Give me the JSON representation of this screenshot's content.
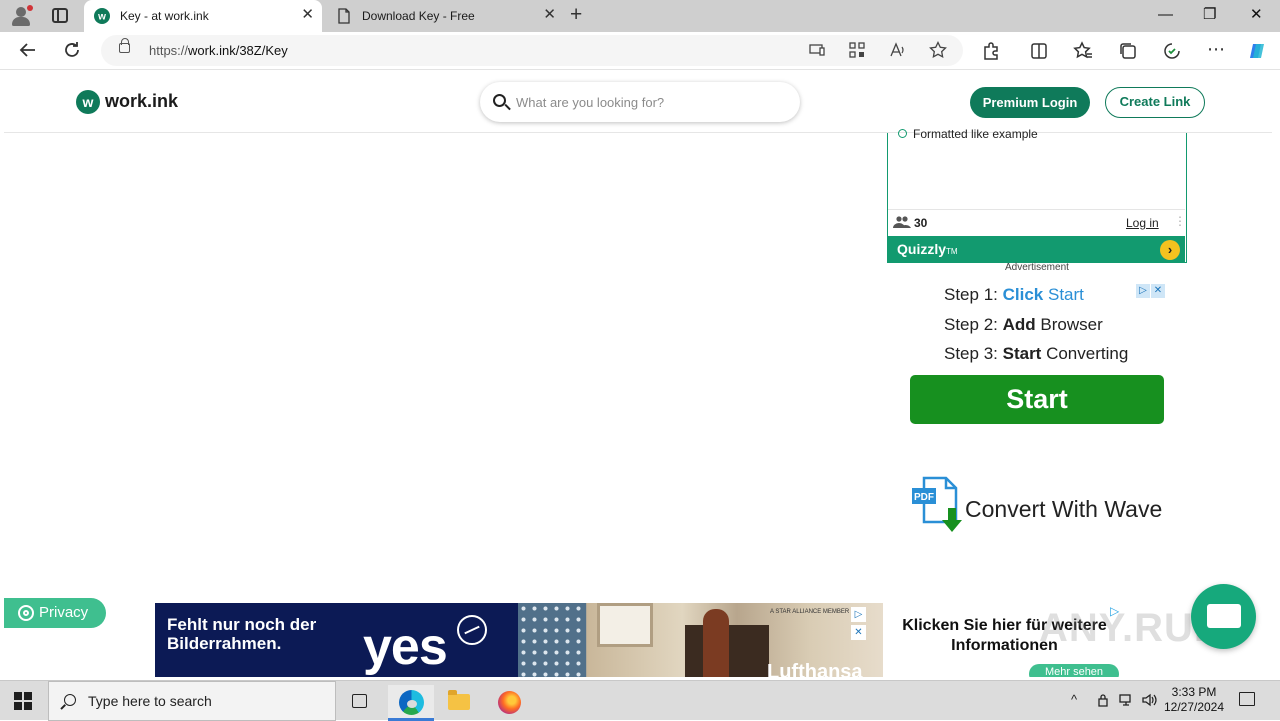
{
  "browser": {
    "tabs": [
      {
        "title": "Key - at work.ink",
        "active": true
      },
      {
        "title": "Download Key - Free",
        "active": false
      }
    ],
    "close_glyph": "✕",
    "new_tab_glyph": "+",
    "window_controls": {
      "minimize": "—",
      "restore": "❐",
      "close": "✕"
    },
    "address": {
      "scheme": "https://",
      "host_path": "work.ink/38Z/Key"
    },
    "icons": [
      "back-icon",
      "refresh-icon",
      "lock-icon",
      "app-available-icon",
      "qr-icon",
      "read-aloud-icon",
      "favorite-icon",
      "extensions-icon",
      "split-screen-icon",
      "favorites-icon",
      "collections-icon",
      "performance-icon",
      "more-icon",
      "copilot-icon"
    ],
    "accent_color": "#0f7a5a"
  },
  "site": {
    "logo_mark": "w",
    "logo_text": "work.ink",
    "search_placeholder": "What are you looking for?",
    "premium_login": "Premium Login",
    "create_link": "Create Link"
  },
  "quiz": {
    "option_text": "Formatted like example",
    "participants": "30",
    "login": "Log in",
    "brand": "Quizzly",
    "brand_tm": "TM",
    "go_glyph": "›"
  },
  "ads": {
    "advertisement_label": "Advertisement",
    "wave": {
      "step1_prefix": "Step 1: ",
      "step1_bold": "Click",
      "step1_rest": "Start",
      "step2_prefix": "Step 2: ",
      "step2_bold": "Add",
      "step2_rest": "Browser",
      "step3_prefix": "Step 3: ",
      "step3_bold": "Start",
      "step3_rest": "Converting",
      "start_button": "Start",
      "pdf_label": "PDF",
      "tagline": "Convert With Wave"
    },
    "banner": {
      "headline_line1": "Fehlt nur noch der",
      "headline_line2": "Bilderrahmen.",
      "yes": "yes",
      "alliance": "A STAR ALLIANCE MEMBER",
      "brand": "Lufthansa"
    },
    "side": {
      "line1": "Klicken Sie hier für weitere",
      "line2": "Informationen",
      "more": "Mehr sehen"
    }
  },
  "privacy_label": "Privacy",
  "watermark": "ANY.RUN",
  "taskbar": {
    "search_placeholder": "Type here to search",
    "time": "3:33 PM",
    "date": "12/27/2024"
  }
}
